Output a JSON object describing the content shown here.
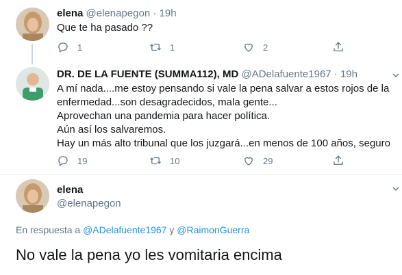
{
  "tweet1": {
    "name": "elena",
    "handle": "@elenapegon",
    "dot": "·",
    "time": "19h",
    "text": "Que te ha pasado ??",
    "reply_count": "1",
    "retweet_count": "1",
    "like_count": "2"
  },
  "tweet2": {
    "name": "DR. DE LA FUENTE (SUMMA112), MD",
    "handle": "@ADelafuente1967",
    "dot": "·",
    "time": "19h",
    "lines": [
      "A mí nada....me estoy pensando si vale la pena salvar a estos rojos de la",
      "enfermedad...son desagradecidos, mala gente...",
      "Aprovechan una pandemia para hacer política.",
      "Aún así los salvaremos.",
      "Hay  un más alto tribunal que los juzgará...en menos de 100 años, seguro"
    ],
    "reply_count": "19",
    "retweet_count": "10",
    "like_count": "29"
  },
  "tweet3": {
    "name": "elena",
    "handle": "@elenapegon",
    "reply_prefix": "En respuesta a",
    "reply_user1": "@ADelafuente1967",
    "reply_and": "y",
    "reply_user2": "@RaimonGuerra",
    "text": "No vale la pena yo les vomitaria encima"
  },
  "icons": {
    "reply": "reply-icon",
    "retweet": "retweet-icon",
    "like": "heart-icon",
    "share": "share-icon",
    "menu": "chevron-down-icon"
  },
  "colors": {
    "text": "#14171a",
    "secondary": "#657786",
    "link": "#1b95e0",
    "divider": "#e6ecf0"
  }
}
